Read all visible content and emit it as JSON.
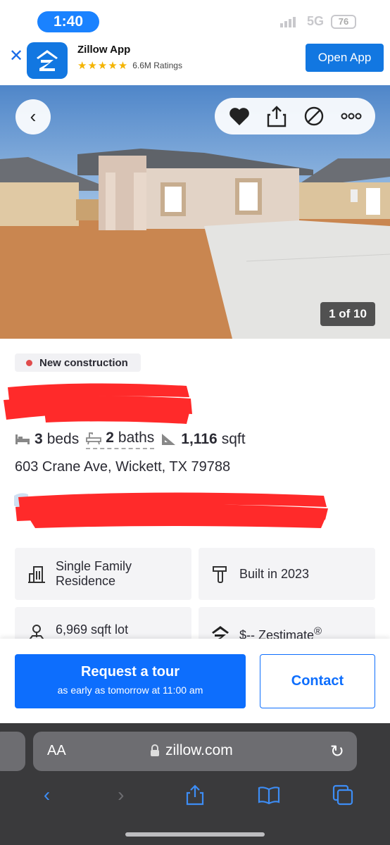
{
  "status_bar": {
    "time": "1:40",
    "network": "5G",
    "battery": "76"
  },
  "app_banner": {
    "app_name": "Zillow App",
    "stars": "★★★★★",
    "ratings": "6.6M Ratings",
    "open_label": "Open App"
  },
  "photo": {
    "counter": "1 of 10"
  },
  "listing": {
    "badge": "New construction",
    "beds_value": "3",
    "beds_unit": "beds",
    "baths_value": "2",
    "baths_unit": "baths",
    "sqft_value": "1,116",
    "sqft_unit": "sqft",
    "address": "603 Crane Ave, Wickett, TX 79788"
  },
  "features": [
    {
      "label_line1": "Single Family",
      "label_line2": "Residence",
      "icon": "building-icon"
    },
    {
      "label_line1": "Built in 2023",
      "icon": "hammer-icon"
    },
    {
      "label_line1": "6,969 sqft lot",
      "icon": "lot-icon"
    },
    {
      "label_line1": "$-- Zestimate",
      "icon": "zestimate-icon"
    }
  ],
  "cta": {
    "tour_title": "Request a tour",
    "tour_sub": "as early as tomorrow at 11:00 am",
    "contact_label": "Contact"
  },
  "browser": {
    "aa_label": "AA",
    "url": "zillow.com"
  },
  "colors": {
    "brand_blue": "#0d6efd",
    "badge_dot": "#e04c4c",
    "redaction": "#ff2a2a"
  }
}
